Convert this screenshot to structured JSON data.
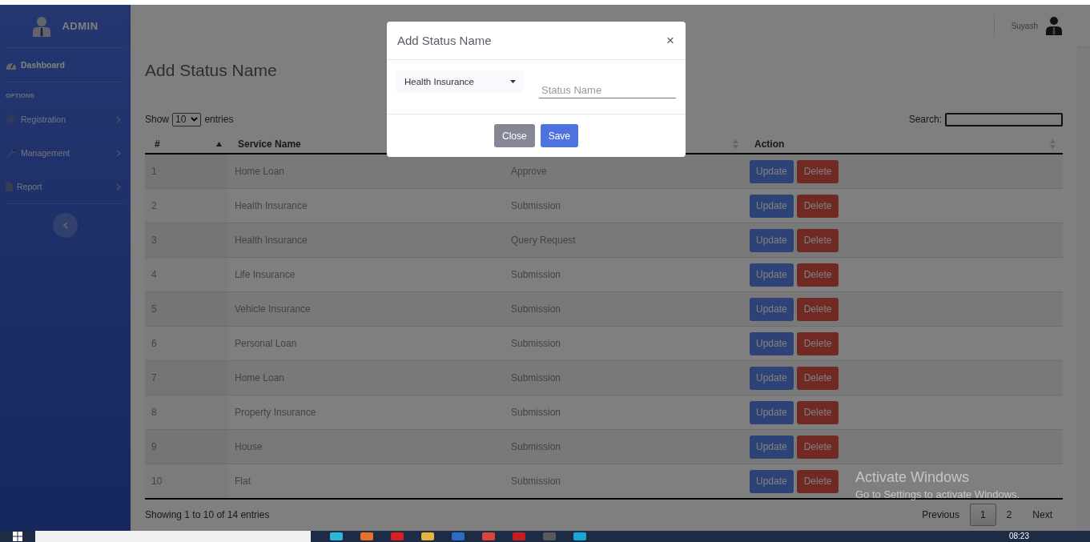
{
  "sidebar": {
    "brand": "ADMIN",
    "items": [
      {
        "kind": "link",
        "label": "Dashboard",
        "selected": true
      },
      {
        "kind": "section",
        "label": "OPTIONS"
      },
      {
        "kind": "submenu",
        "label": "Registration",
        "selected": false
      },
      {
        "kind": "submenu",
        "label": "Management",
        "selected": false
      },
      {
        "kind": "submenu",
        "label": "Report",
        "selected": false
      }
    ]
  },
  "header": {
    "user": "Suyash"
  },
  "page_title": "Add Status Name",
  "table_controls": {
    "show_label": "Show",
    "page_size": "10",
    "entries_label": "entries",
    "search_label": "Search:"
  },
  "table": {
    "columns": [
      {
        "label": "#"
      },
      {
        "label": "Service Name"
      },
      {},
      {
        "label": "Action"
      }
    ],
    "rows": [
      {
        "cells": [
          "1",
          "Home Loan",
          "Approve"
        ],
        "actions": [
          "Update",
          "Delete"
        ]
      },
      {
        "cells": [
          "2",
          "Health Insurance",
          "Submission"
        ],
        "actions": [
          "Update",
          "Delete"
        ]
      },
      {
        "cells": [
          "3",
          "Health Insurance",
          "Query Request"
        ],
        "actions": [
          "Update",
          "Delete"
        ]
      },
      {
        "cells": [
          "4",
          "Life Insurance",
          "Submission"
        ],
        "actions": [
          "Update",
          "Delete"
        ]
      },
      {
        "cells": [
          "5",
          "Vehicle Insurance",
          "Submission"
        ],
        "actions": [
          "Update",
          "Delete"
        ]
      },
      {
        "cells": [
          "6",
          "Personal Loan",
          "Submission"
        ],
        "actions": [
          "Update",
          "Delete"
        ]
      },
      {
        "cells": [
          "7",
          "Home Loan",
          "Submission"
        ],
        "actions": [
          "Update",
          "Delete"
        ]
      },
      {
        "cells": [
          "8",
          "Property Insurance",
          "Submission"
        ],
        "actions": [
          "Update",
          "Delete"
        ]
      },
      {
        "cells": [
          "9",
          "House",
          "Submission"
        ],
        "actions": [
          "Update",
          "Delete"
        ]
      },
      {
        "cells": [
          "10",
          "Flat",
          "Submission"
        ],
        "actions": [
          "Update",
          "Delete"
        ]
      }
    ]
  },
  "footer": {
    "info": "Showing 1 to 10 of 14 entries",
    "pagination": [
      {
        "label": "Previous",
        "selected": false
      },
      {
        "label": "1",
        "selected": true
      },
      {
        "label": "2",
        "selected": false
      },
      {
        "label": "Next",
        "selected": false
      }
    ]
  },
  "modal": {
    "title": "Add Status Name",
    "close": "×",
    "service_select": "Health Insurance",
    "status_field": {
      "placeholder": "Status Name"
    },
    "buttons": [
      {
        "label": "Close",
        "kind": "secondary"
      },
      {
        "label": "Save",
        "kind": "primary"
      }
    ]
  },
  "os_notice": {
    "title": "Activate Windows",
    "text": "Go to Settings to activate Windows."
  },
  "taskbar": {
    "clock": "08:23"
  }
}
